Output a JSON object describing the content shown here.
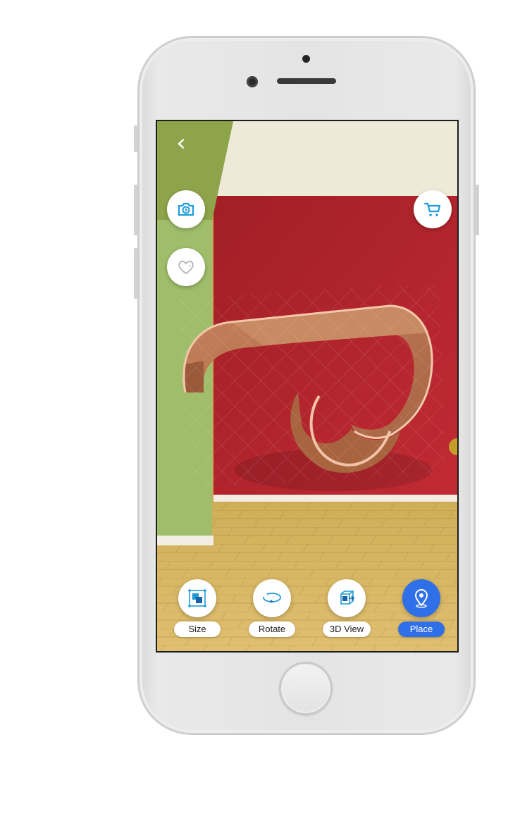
{
  "app": {
    "back_glyph": "‹",
    "actions": {
      "camera_icon": "camera-icon",
      "favorite_icon": "heart-icon",
      "cart_icon": "cart-icon"
    },
    "toolbar": [
      {
        "label": "Size",
        "icon": "size-icon",
        "active": false
      },
      {
        "label": "Rotate",
        "icon": "rotate-icon",
        "active": false
      },
      {
        "label": "3D View",
        "icon": "3d-view-icon",
        "active": false
      },
      {
        "label": "Place",
        "icon": "place-icon",
        "active": true
      }
    ]
  },
  "colors": {
    "accent": "#2f6fe8",
    "icon_blue": "#1e9bd7",
    "wall_red": "#b8252d",
    "wall_green": "#9fbd6a",
    "floor": "#d6b55f"
  }
}
